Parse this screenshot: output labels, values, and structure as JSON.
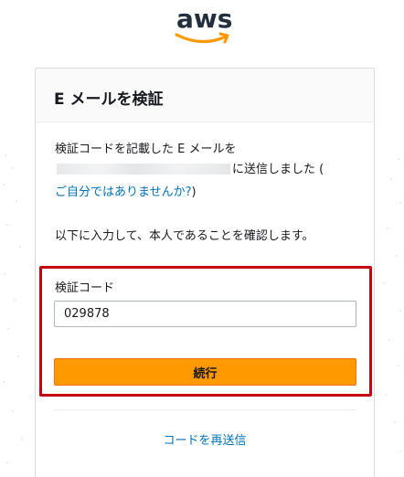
{
  "brand": {
    "logo_text": "aws",
    "logo_text_color": "#232f3e",
    "smile_color": "#ff9900",
    "icon": "aws-logo-icon"
  },
  "card": {
    "title": "E メールを検証",
    "message_line1": "検証コードを記載した E メールを",
    "message_line2_suffix": "に送信しました (",
    "not_you_link": "ご自分ではありませんか?",
    "not_you_close": ")",
    "instruction": "以下に入力して、本人であることを確認します。"
  },
  "form": {
    "code_label": "検証コード",
    "code_value": "029878",
    "continue_label": "続行",
    "resend_label": "コードを再送信"
  },
  "colors": {
    "primary_button": "#ff9900",
    "link": "#0073bb",
    "highlight_border": "#c40511"
  }
}
